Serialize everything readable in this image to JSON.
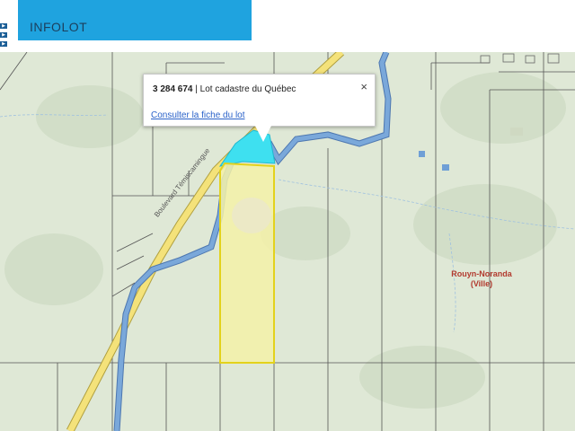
{
  "header": {
    "title": "INFOLOT",
    "side_tabs": [
      "▶",
      "▶",
      "▶"
    ]
  },
  "popup": {
    "lot_number": "3 284 674",
    "lot_type": " | Lot cadastre du Québec",
    "link_label": "Consulter la fiche du lot",
    "close_label": "×"
  },
  "map": {
    "place_label_line1": "Rouyn-Noranda",
    "place_label_line2": "(Ville)",
    "road_label": "Boulevard Témiscamingue",
    "colors": {
      "land": "#dfe8d6",
      "road": "#f4e27a",
      "water": "#7aa8da",
      "selected_lot_fill": "#f4f1a8",
      "selected_lot_stroke": "#e3d21c",
      "highlight_water": "#3ee0f0",
      "banner": "#1fa3df"
    }
  }
}
